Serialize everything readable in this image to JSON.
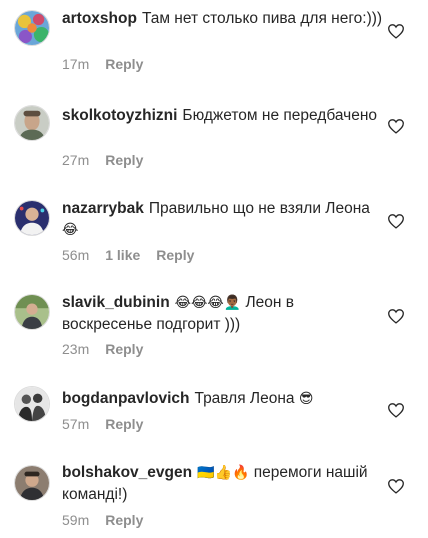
{
  "comments": [
    {
      "username": "artoxshop",
      "text": "Там нет столько пива для него:)))",
      "time": "17m",
      "likes": "",
      "reply": "Reply",
      "emoji": "",
      "avatar_color": "#6aa6d8"
    },
    {
      "username": "skolkotoyzhizni",
      "text": "Бюджетом не передбачено",
      "time": "27m",
      "likes": "",
      "reply": "Reply",
      "emoji": "",
      "avatar_color": "#8b8e86"
    },
    {
      "username": "nazarrybak",
      "text": "Правильно що не взяли Леона",
      "time": "56m",
      "likes": "1 like",
      "reply": "Reply",
      "emoji": "😂",
      "avatar_color": "#3c4aa0"
    },
    {
      "username": "slavik_dubinin",
      "text": "Леон в воскресенье подгорит )))",
      "time": "23m",
      "likes": "",
      "reply": "Reply",
      "emoji": "😂😂😂👨🏾‍🦱",
      "avatar_color": "#5c7a44"
    },
    {
      "username": "bogdanpavlovich",
      "text": "Травля Леона",
      "time": "57m",
      "likes": "",
      "reply": "Reply",
      "emoji": "😎",
      "avatar_color": "#4a4a4a"
    },
    {
      "username": "bolshakov_evgen",
      "text": "перемоги нашій команді!)",
      "time": "59m",
      "likes": "",
      "reply": "Reply",
      "emoji": "🇺🇦👍🔥",
      "avatar_color": "#6a5a4e"
    }
  ],
  "colors": {
    "text": "#262626",
    "meta": "#8e8e8e",
    "heart": "#262626"
  },
  "icons": {
    "like": "heart-outline-icon"
  }
}
